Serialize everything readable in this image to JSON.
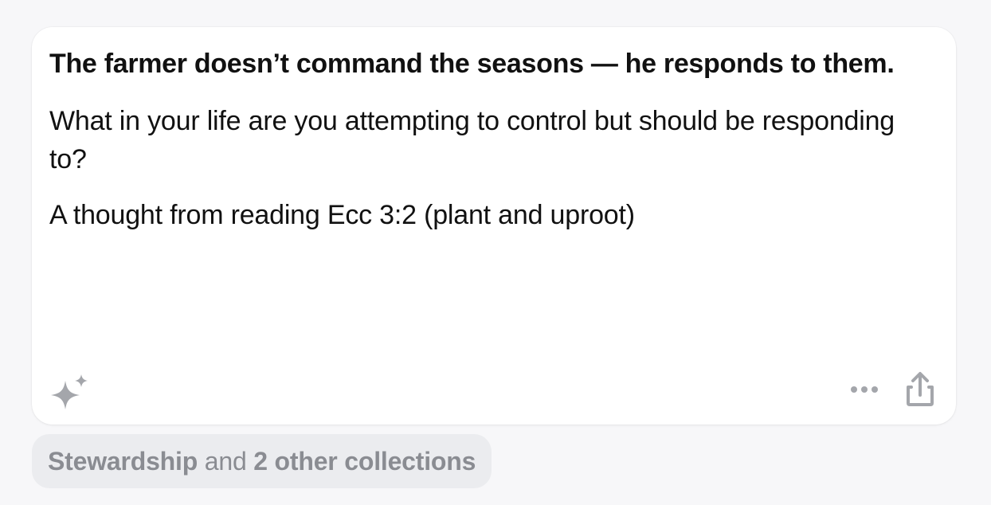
{
  "note": {
    "title": "The farmer doesn’t command the seasons — he responds to them.",
    "body": "What in your life are you attempting to control but should be responding to?",
    "source": "A thought from reading Ecc 3:2 (plant and uproot)"
  },
  "toolbar": {
    "sparkle_icon": "sparkles-icon",
    "more_icon": "ellipsis-icon",
    "share_icon": "share-icon"
  },
  "collections": {
    "primary": "Stewardship",
    "connector": " and ",
    "others": "2 other collections"
  },
  "colors": {
    "background": "#f7f7f9",
    "card": "#ffffff",
    "text": "#111111",
    "icon": "#a4a6ab",
    "pill_bg": "#ebecef",
    "pill_text": "#8a8c92"
  }
}
